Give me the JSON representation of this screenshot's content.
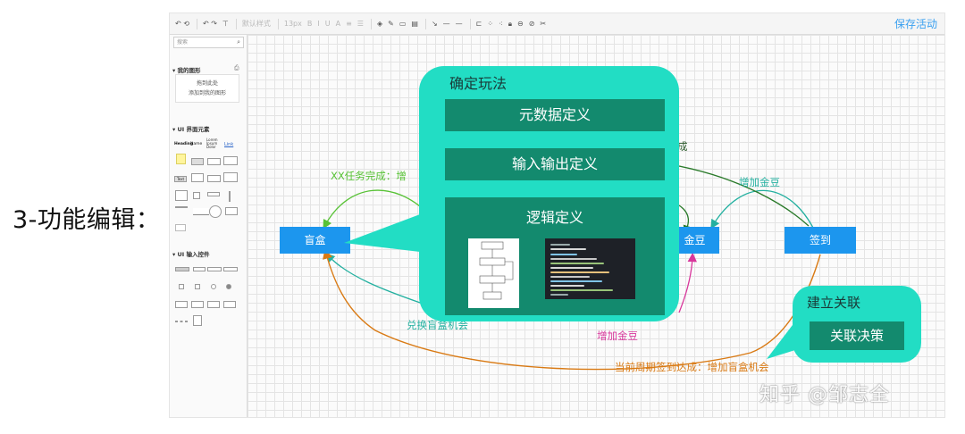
{
  "side_label": "3-功能编辑：",
  "toolbar": {
    "save_label": "保存活动",
    "font_style_hint": "默认样式",
    "font_size": "13px",
    "bold": "B",
    "italic": "I",
    "underline": "U",
    "text_a": "A"
  },
  "sidebar": {
    "search_placeholder": "搜索",
    "my_shapes_title": "我的图形",
    "dropzone_line1": "拖到此处",
    "dropzone_line2": "添加到我的图形",
    "ui_elements_title": "UI 界面元素",
    "ui_inputs_title": "UI 输入控件",
    "sample_heading": "Heading",
    "sample_name": "Name",
    "sample_lorem": "Lorem Ipsum Dolor",
    "sample_link": "Link",
    "sample_text": "Text"
  },
  "diagram": {
    "nodes": {
      "blindbox": "盲盒",
      "golden_bean": "金豆",
      "checkin": "签到"
    },
    "edge_labels": {
      "task_complete": "XX任务完成：增",
      "complete_suffix": "成",
      "add_gold_top": "增加金豆",
      "exchange_blindbox": "兑换盲盒机会",
      "add_gold_bottom": "增加金豆",
      "checkin_reward": "当前周期签到达成：增加盲盒机会"
    },
    "callout": {
      "title": "确定玩法",
      "metadata": "元数据定义",
      "io": "输入输出定义",
      "logic": "逻辑定义"
    },
    "relation": {
      "title": "建立关联",
      "button": "关联决策"
    }
  },
  "watermark": "知乎 @邹志全",
  "colors": {
    "node_blue": "#1c96ee",
    "callout_teal": "#22ddc4",
    "bar_green": "#138a6e",
    "edge_green": "#58c236",
    "edge_teal": "#23b0a0",
    "edge_orange": "#d97a14",
    "edge_magenta": "#d8369b",
    "edge_darkgreen": "#2a7a2a",
    "save_blue": "#3aa0f0"
  },
  "icons": [
    "undo-icon",
    "redo-icon",
    "format-icon",
    "bold-icon",
    "italic-icon",
    "underline-icon",
    "text-color-icon",
    "fill-icon",
    "line-color-icon",
    "shadow-icon",
    "connector-icon",
    "line-style-icon",
    "arrow-icon",
    "align-icon",
    "arrange-icon",
    "lock-icon",
    "link-icon",
    "clear-format-icon",
    "search-icon",
    "collapse-triangle-icon"
  ]
}
